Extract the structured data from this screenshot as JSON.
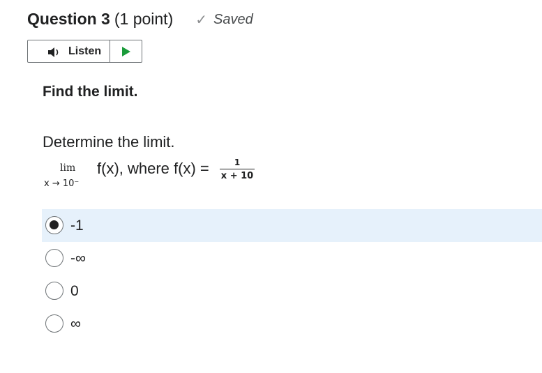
{
  "question": {
    "title": "Question 3",
    "points": "(1 point)",
    "status": "Saved",
    "status_icon": "check-icon"
  },
  "listen": {
    "label": "Listen",
    "menu_icon": "menu-icon",
    "speaker_icon": "speaker-icon",
    "play_icon": "play-icon",
    "play_color": "#1a9b3a"
  },
  "prompt": "Find the limit.",
  "body": {
    "instruction": "Determine the limit.",
    "lim_text": "lim",
    "lim_sub": "x → 10⁻",
    "function_text": "f(x), where f(x) =",
    "numerator": "1",
    "denominator": "x + 10"
  },
  "options": [
    {
      "label": "-1",
      "selected": true
    },
    {
      "label": "-∞",
      "selected": false
    },
    {
      "label": "0",
      "selected": false
    },
    {
      "label": "∞",
      "selected": false
    }
  ],
  "colors": {
    "selected_row": "#e6f1fb",
    "text": "#202122"
  }
}
